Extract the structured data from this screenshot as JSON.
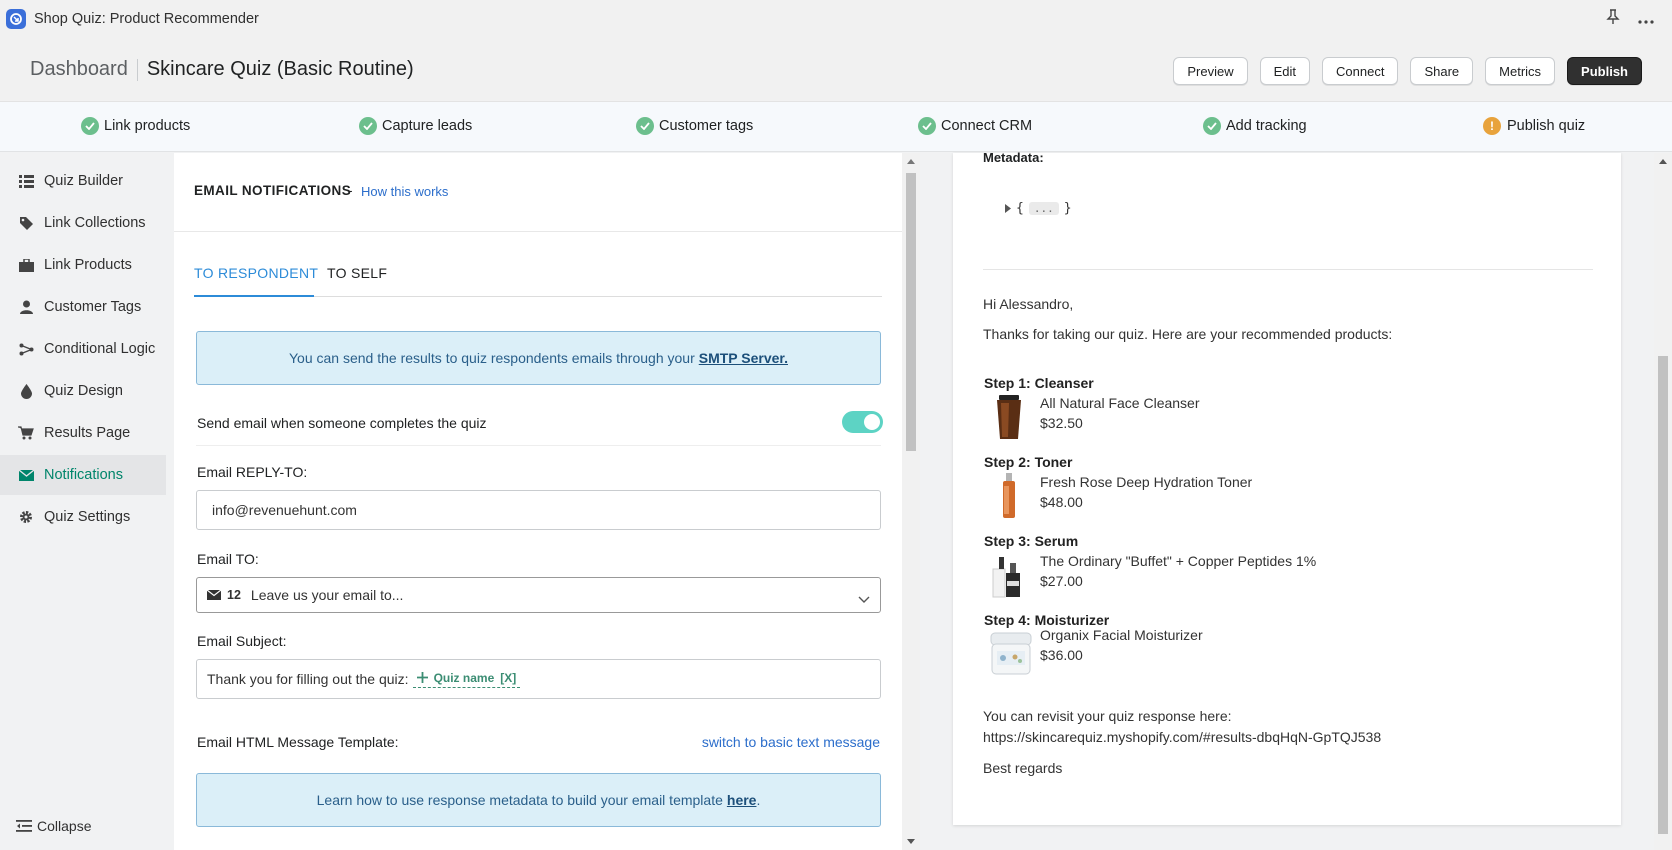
{
  "app": {
    "title": "Shop Quiz: Product Recommender"
  },
  "header": {
    "breadcrumb_root": "Dashboard",
    "page_title": "Skincare Quiz (Basic Routine)",
    "buttons": {
      "preview": "Preview",
      "edit": "Edit",
      "connect": "Connect",
      "share": "Share",
      "metrics": "Metrics",
      "publish": "Publish"
    }
  },
  "steps": [
    {
      "label": "Link products",
      "status": "done"
    },
    {
      "label": "Capture leads",
      "status": "done"
    },
    {
      "label": "Customer tags",
      "status": "done"
    },
    {
      "label": "Connect CRM",
      "status": "done"
    },
    {
      "label": "Add tracking",
      "status": "done"
    },
    {
      "label": "Publish quiz",
      "status": "pending"
    }
  ],
  "sidebar": {
    "items": [
      {
        "label": "Quiz Builder",
        "icon": "list-icon"
      },
      {
        "label": "Link Collections",
        "icon": "tag-icon"
      },
      {
        "label": "Link Products",
        "icon": "box-icon"
      },
      {
        "label": "Customer Tags",
        "icon": "user-icon"
      },
      {
        "label": "Conditional Logic",
        "icon": "branch-icon"
      },
      {
        "label": "Quiz Design",
        "icon": "drop-icon"
      },
      {
        "label": "Results Page",
        "icon": "cart-icon"
      },
      {
        "label": "Notifications",
        "icon": "envelope-icon",
        "active": true
      },
      {
        "label": "Quiz Settings",
        "icon": "gear-icon"
      }
    ],
    "collapse": "Collapse"
  },
  "notifications": {
    "heading": "EMAIL NOTIFICATIONS",
    "dash": "-",
    "how_link": "How this works",
    "tabs": {
      "respondent": "TO RESPONDENT",
      "self": "TO SELF"
    },
    "smtp_info": "You can send the results to quiz respondents emails through your",
    "smtp_link": "SMTP Server.",
    "send_label": "Send email when someone completes the quiz",
    "send_enabled": true,
    "reply_to_label": "Email REPLY-TO:",
    "reply_to_value": "info@revenuehunt.com",
    "to_label": "Email TO:",
    "to_count": "12",
    "to_value": "Leave us your email to...",
    "subject_label": "Email Subject:",
    "subject_text": "Thank you for filling out the quiz:",
    "subject_tag": "Quiz name",
    "subject_tag_x": "[X]",
    "template_label": "Email HTML Message Template:",
    "switch_link": "switch to basic text message",
    "metadata_info": "Learn how to use response metadata to build your email template",
    "metadata_link": "here",
    "metadata_period": "."
  },
  "preview": {
    "metadata_label": "Metadata:",
    "metadata_open": "{",
    "metadata_dots": "...",
    "metadata_close": "}",
    "greeting": "Hi Alessandro,",
    "intro": "Thanks for taking our quiz. Here are your recommended products:",
    "products": [
      {
        "step": "Step 1: Cleanser",
        "name": "All Natural Face Cleanser",
        "price": "$32.50"
      },
      {
        "step": "Step 2: Toner",
        "name": "Fresh Rose Deep Hydration Toner",
        "price": "$48.00"
      },
      {
        "step": "Step 3: Serum",
        "name": "The Ordinary \"Buffet\" + Copper Peptides 1%",
        "price": "$27.00"
      },
      {
        "step": "Step 4: Moisturizer",
        "name": "Organix Facial Moisturizer",
        "price": "$36.00"
      }
    ],
    "revisit": "You can revisit your quiz response here:",
    "revisit_url": "https://skincarequiz.myshopify.com/#results-dbqHqN-GpTQJ538",
    "signoff": "Best regards"
  },
  "colors": {
    "accent": "#2c8bd8",
    "success": "#6cbf8d",
    "warning": "#e8a33c",
    "active_nav": "#00856b",
    "toggle": "#5dd3c4"
  }
}
